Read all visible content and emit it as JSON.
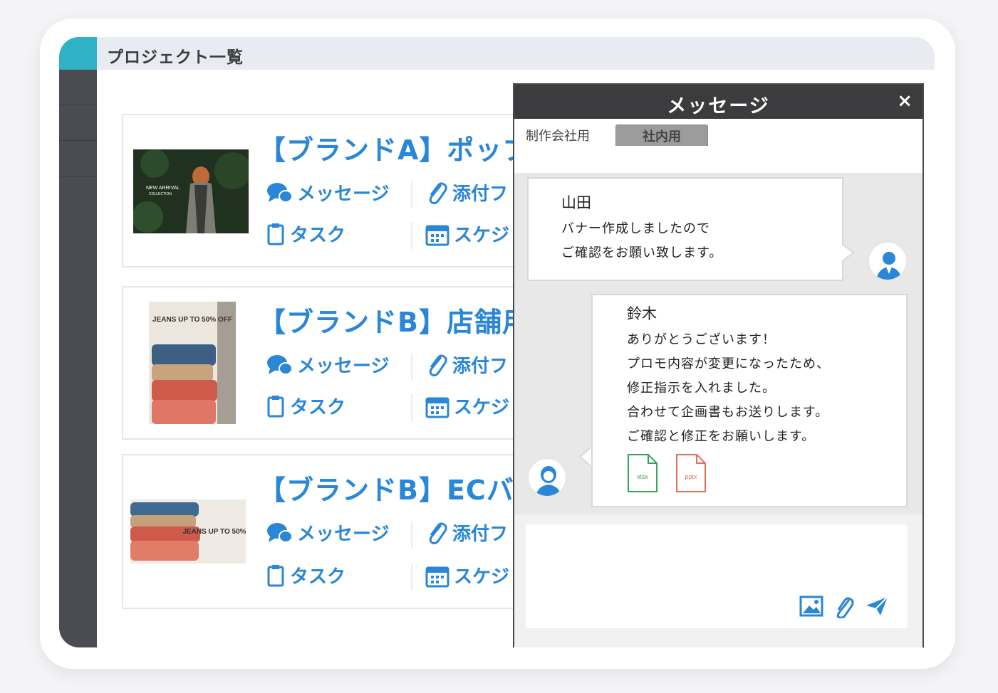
{
  "header": {
    "title": "プロジェクト一覧"
  },
  "projects": [
    {
      "title": "【ブランドA】ポップ",
      "actions": {
        "message": "メッセージ",
        "attachment": "添付フ",
        "task": "タスク",
        "schedule": "スケジ"
      }
    },
    {
      "title": "【ブランドB】店舗用",
      "thumb_text": "JEANS UP TO 50% OFF",
      "actions": {
        "message": "メッセージ",
        "attachment": "添付フ",
        "task": "タスク",
        "schedule": "スケジ"
      }
    },
    {
      "title": "【ブランドB】ECバ",
      "thumb_text": "JEANS UP TO 50%OFF",
      "actions": {
        "message": "メッセージ",
        "attachment": "添付フ",
        "task": "タスク",
        "schedule": "スケジ"
      }
    }
  ],
  "message_panel": {
    "title": "メッセージ",
    "close": "×",
    "tabs": [
      "制作会社用",
      "社内用"
    ],
    "messages": [
      {
        "name": "山田",
        "lines": [
          "バナー作成しましたので",
          "ご確認をお願い致します。"
        ]
      },
      {
        "name": "鈴木",
        "lines": [
          "ありがとうございます！",
          "プロモ内容が変更になったため、",
          "修正指示を入れました。",
          "合わせて企画書もお送りします。",
          "ご確認と修正をお願いします。"
        ],
        "files": [
          "xlsx",
          "pptx"
        ]
      }
    ]
  },
  "colors": {
    "accent": "#2a86d6",
    "teal": "#2fb1c6",
    "sidebar": "#4a4c52"
  }
}
